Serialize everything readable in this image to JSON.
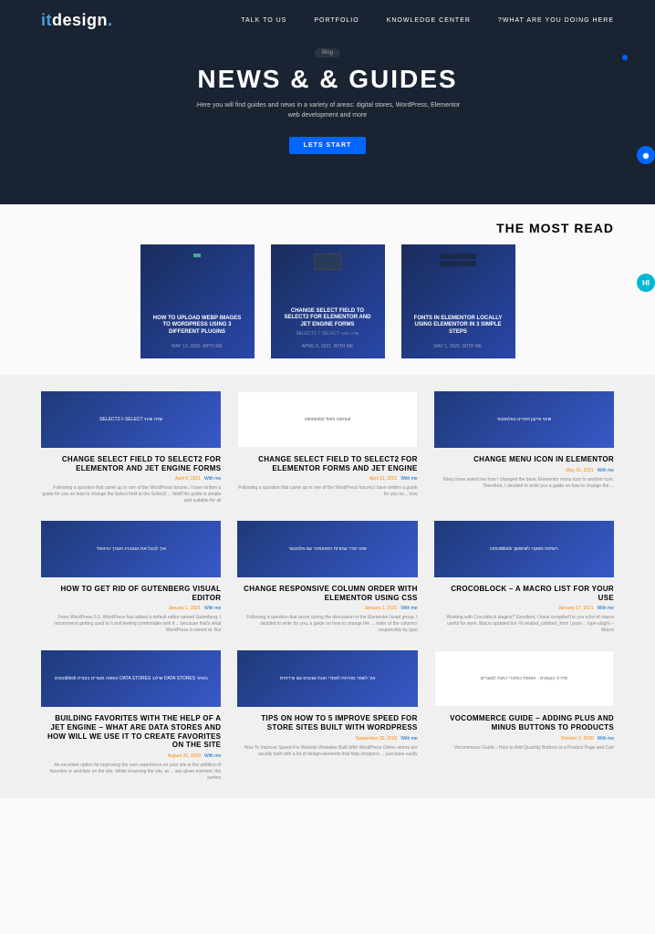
{
  "brand": {
    "prefix": "it",
    "main": "design",
    "dot": "."
  },
  "nav": {
    "talk": "TALK TO US",
    "portfolio": "PORTFOLIO",
    "knowledge": "KNOWLEDGE CENTER",
    "what": "?WHAT ARE YOU DOING HERE"
  },
  "hero": {
    "badge": "Blog",
    "title": "NEWS & & GUIDES",
    "sub1": ".Here you will find guides and news in a variety of areas: digital stores, WordPress, Elementor",
    "sub2": "web development and more",
    "cta": "LETS START"
  },
  "most_read": {
    "title": "THE MOST READ",
    "cards": [
      {
        "title": "HOW TO UPLOAD WEBP IMAGES TO WORDPRESS USING 3 DIFFERENT PLUGINS",
        "meta": "MAY 13, 2020  .WITH ME",
        "sub": ""
      },
      {
        "title": "CHANGE SELECT FIELD TO SELECT2 FOR ELEMENTOR AND JET ENGINE FORMS",
        "meta": "APRIL 6, 2021  .WITH ME",
        "sub": "SELECT2-7 SELECT שדה שינוי"
      },
      {
        "title": "FONTS IN ELEMENTOR LOCALLY USING ELEMENTOR IN 3 SIMPLE STEPS",
        "meta": "MAY 1, 2020  .WITH ME",
        "sub": ""
      }
    ]
  },
  "posts": [
    {
      "img_txt": "SELECT2-ל SELECT שדה שינוי",
      "title": "CHANGE SELECT FIELD TO SELECT2 FOR ELEMENTOR AND JET ENGINE FORMS",
      "date": "April 6, 2021",
      "author": "With me",
      "excerpt": "Following a question that came up in one of the WordPress forums, I have written a guide for you on how to change the Select field to the Select2 ... fieldThis guide is simple and suitable for all"
    },
    {
      "img_txt": "elementor form normal",
      "title": "CHANGE SELECT FIELD TO SELECT2 FOR ELEMENTOR FORMS AND JET ENGINE",
      "date": "April 11, 2021",
      "author": "With me",
      "excerpt": "Following a question that came up in one of the WordPress forums,I have written a guide for you on ...how",
      "white": true
    },
    {
      "img_txt": "שינוי אייקון תפריט באלמנטור",
      "title": "CHANGE MENU ICON IN ELEMENTOR",
      "date": "May 31, 2021",
      "author": "With me",
      "excerpt": "Many have asked me how I changed the basic Elementor menu icon to another icon. Therefore, I decided to write you a guide on how to change the ..."
    },
    {
      "img_txt": "איך לבטל את גוטנברג העורך הויזואלי",
      "title": "HOW TO GET RID OF GUTENBERG VISUAL EDITOR",
      "date": "January 1, 2021",
      "author": "With me",
      "excerpt": "From WordPress 5.0, WordPress has added a default editor named Gutenberg. I recommend getting used to it and feeling comfortable with it ... because that's what WordPress is aimed at. But"
    },
    {
      "img_txt": "שינוי סדר עמודות רספונסיבי עם אלמנטור",
      "title": "CHANGE RESPONSIVE COLUMN ORDER WITH ELEMENTOR USING CSS",
      "date": "January 1, 2021",
      "author": "With me",
      "excerpt": "Following a question that arose during the discussion in the Elementor Israel group, I decided to write for you, a guide on how to change the ... order of the columns responsibly by typo"
    },
    {
      "img_txt": "crocoblock רשימת מאקרו לשימושך",
      "title": "CROCOBLOCK – A MACRO LIST FOR YOUR USE",
      "date": "January 17, 2021",
      "author": "With me",
      "excerpt": "Working with Crocoblock plugins? Excellent, I have compiled for you a list of macro useful for work. Macro updated list -% related_children_from | post-... type-slug% – Macro"
    },
    {
      "img_txt": "crocoblock הוספה מוצרים בעזרת DATA STORES שילוב DATA STORES באתר",
      "title": "BUILDING FAVORITES WITH THE HELP OF A JET ENGINE – WHAT ARE DATA STORES AND HOW WILL WE USE IT TO CREATE FAVORITES ON THE SITE",
      "date": "August 26, 2020",
      "author": "With me",
      "excerpt": "An excellent option for improving the user experience on your site is the addition of favorites or wishlists on the site. While browsing the site, at ... any given moment, the surfers"
    },
    {
      "img_txt": "איך לשפר מהירות לאתרי חנות שבונים עם וורדפרס",
      "title": "TIPS ON HOW TO 5 IMPROVE SPEED FOR STORE SITES BUILT WITH WORDPRESS",
      "date": "September 20, 2020",
      "author": "With me",
      "excerpt": "How To Improve Speed For Website Websites Built With WordPress Online stores are usually built with a lot of design elements that help shoppers ... purchase easily"
    },
    {
      "img_txt": "מדריך ווקומרס - הוספת כפתורי כמות למוצרים",
      "title": "VOCOMMERCE GUIDE – ADDING PLUS AND MINUS BUTTONS TO PRODUCTS",
      "date": "October 3, 2020",
      "author": "With me",
      "excerpt": "Vocommorce Guide – How to Add Quantity Buttons to a Product Page and Cart",
      "white": true
    }
  ],
  "fab": {
    "hi": "HI"
  }
}
